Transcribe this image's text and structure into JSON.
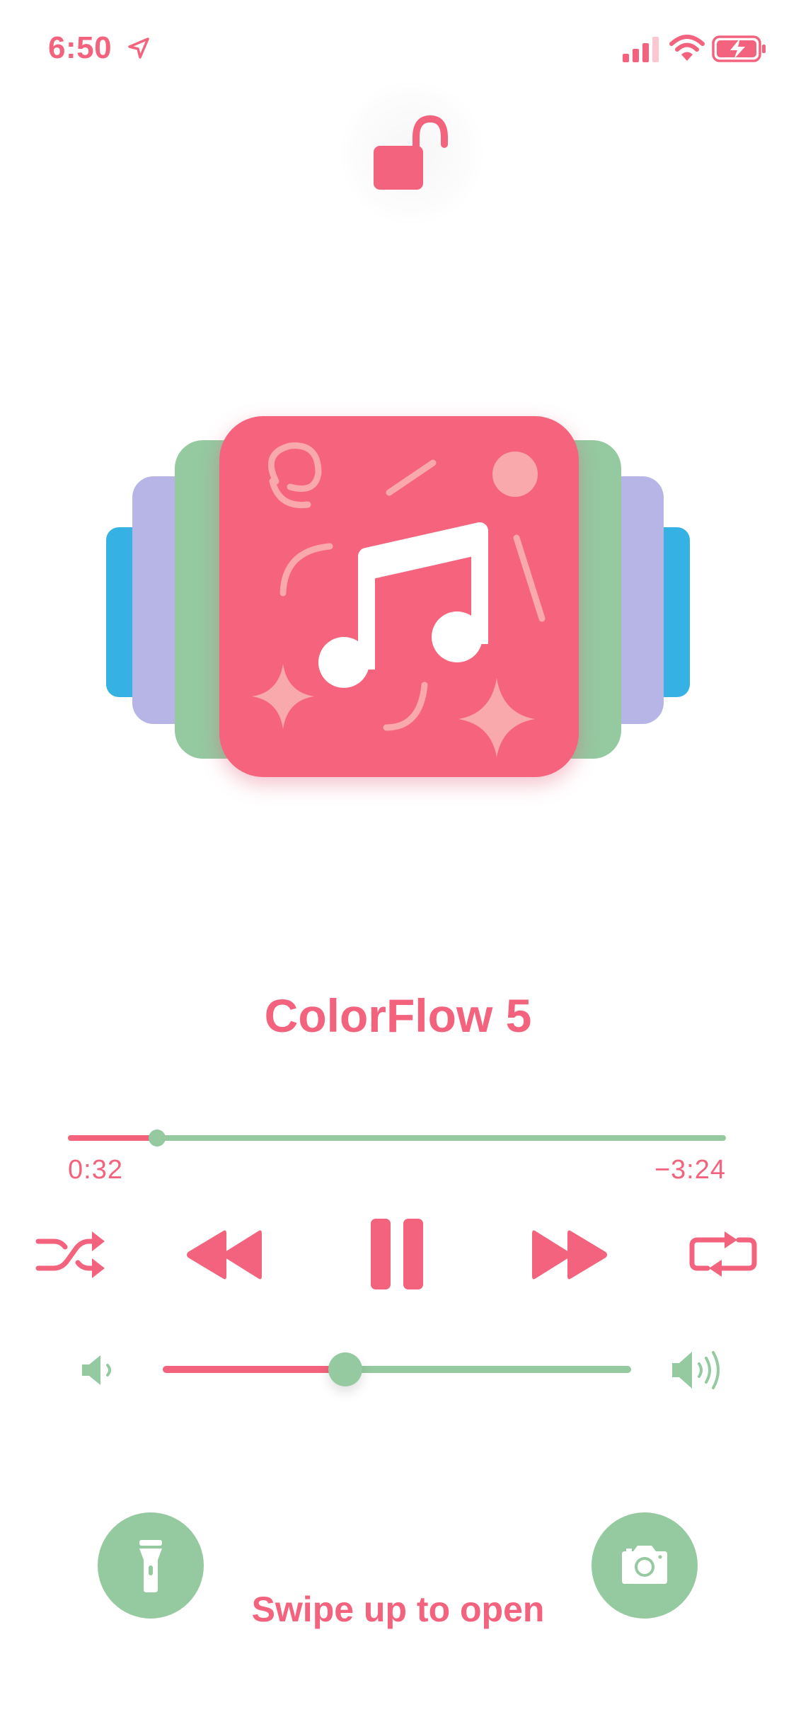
{
  "status_bar": {
    "time": "6:50",
    "icons": [
      "location-arrow-icon",
      "cellular-signal-icon",
      "wifi-icon",
      "battery-charging-icon"
    ]
  },
  "lock": {
    "icon": "unlocked-padlock-icon"
  },
  "artwork": {
    "icon": "music-note-icon",
    "stack_colors": [
      "#35b2e3",
      "#b6b5e6",
      "#95c9a0",
      "#f5637d"
    ]
  },
  "now_playing": {
    "title": "ColorFlow 5",
    "elapsed": "0:32",
    "remaining": "−3:24",
    "progress_fraction": 0.136
  },
  "controls": {
    "shuffle": "shuffle-icon",
    "previous": "rewind-icon",
    "play_pause": "pause-icon",
    "next": "fast-forward-icon",
    "repeat": "repeat-icon"
  },
  "volume": {
    "level_fraction": 0.39,
    "low_icon": "speaker-low-icon",
    "high_icon": "speaker-high-icon"
  },
  "bottom": {
    "hint": "Swipe up to open",
    "left_button": "flashlight-icon",
    "right_button": "camera-icon"
  },
  "colors": {
    "accent": "#f3637e",
    "secondary": "#95c9a0",
    "background": "#ffffff"
  }
}
